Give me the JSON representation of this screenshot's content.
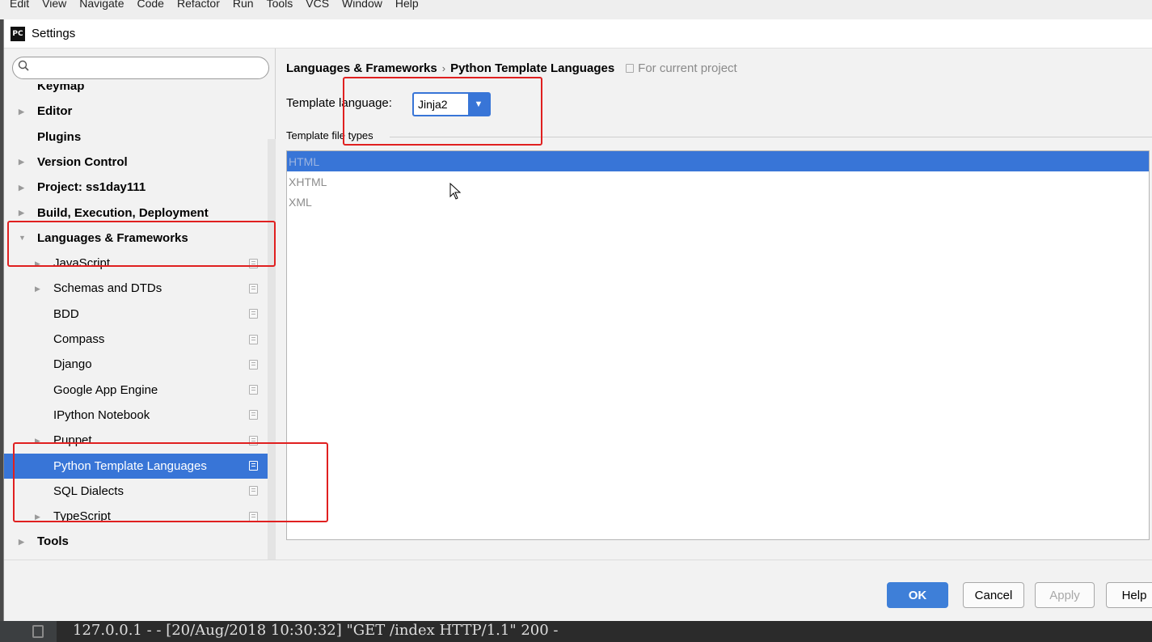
{
  "menubar": {
    "items": [
      "Edit",
      "View",
      "Navigate",
      "Code",
      "Refactor",
      "Run",
      "Tools",
      "VCS",
      "Window",
      "Help"
    ]
  },
  "dialog": {
    "logo": "PC",
    "title": "Settings"
  },
  "search": {
    "placeholder": ""
  },
  "tree": [
    {
      "label": "Keymap",
      "top": true,
      "arrow": false
    },
    {
      "label": "Editor",
      "top": true,
      "arrow": "right"
    },
    {
      "label": "Plugins",
      "top": true,
      "arrow": false
    },
    {
      "label": "Version Control",
      "top": true,
      "arrow": "right"
    },
    {
      "label": "Project: ss1day111",
      "top": true,
      "arrow": "right"
    },
    {
      "label": "Build, Execution, Deployment",
      "top": true,
      "arrow": "right"
    },
    {
      "label": "Languages & Frameworks",
      "top": true,
      "arrow": "down"
    },
    {
      "label": "JavaScript",
      "top": false,
      "arrow": "right",
      "project": true
    },
    {
      "label": "Schemas and DTDs",
      "top": false,
      "arrow": "right",
      "project": true
    },
    {
      "label": "BDD",
      "top": false,
      "arrow": false,
      "project": true
    },
    {
      "label": "Compass",
      "top": false,
      "arrow": false,
      "project": true
    },
    {
      "label": "Django",
      "top": false,
      "arrow": false,
      "project": true
    },
    {
      "label": "Google App Engine",
      "top": false,
      "arrow": false,
      "project": true
    },
    {
      "label": "IPython Notebook",
      "top": false,
      "arrow": false,
      "project": true
    },
    {
      "label": "Puppet",
      "top": false,
      "arrow": "right",
      "project": true
    },
    {
      "label": "Python Template Languages",
      "top": false,
      "arrow": false,
      "project": true,
      "selected": true
    },
    {
      "label": "SQL Dialects",
      "top": false,
      "arrow": false,
      "project": true
    },
    {
      "label": "TypeScript",
      "top": false,
      "arrow": "right",
      "project": true
    },
    {
      "label": "Tools",
      "top": true,
      "arrow": "right"
    }
  ],
  "breadcrumb": {
    "parent": "Languages & Frameworks",
    "separator": "›",
    "current": "Python Template Languages",
    "scope": "For current project"
  },
  "template_language": {
    "label": "Template language:",
    "value": "Jinja2"
  },
  "file_types": {
    "title": "Template file types",
    "items": [
      "HTML",
      "XHTML",
      "XML"
    ],
    "selected_index": 0
  },
  "buttons": {
    "ok": "OK",
    "cancel": "Cancel",
    "apply": "Apply",
    "help": "Help"
  },
  "console": {
    "text": "127.0.0.1 - - [20/Aug/2018 10:30:32] \"GET /index HTTP/1.1\" 200 -"
  },
  "colors": {
    "selection": "#3875d7",
    "annotation": "#e02020",
    "dialog_bg": "#f2f2f2"
  }
}
